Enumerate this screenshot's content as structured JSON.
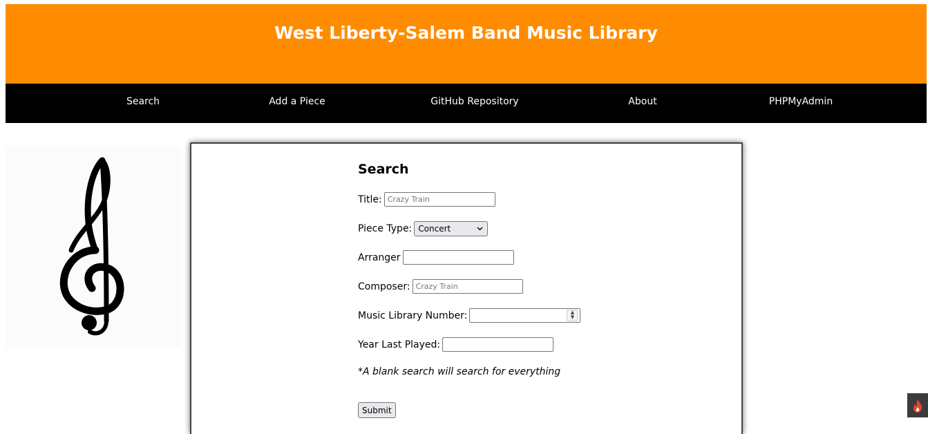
{
  "header": {
    "title": "West Liberty-Salem Band Music Library"
  },
  "nav": {
    "items": [
      {
        "label": "Search"
      },
      {
        "label": "Add a Piece"
      },
      {
        "label": "GitHub Repository"
      },
      {
        "label": "About"
      },
      {
        "label": "PHPMyAdmin"
      }
    ]
  },
  "form": {
    "heading": "Search",
    "title_label": "Title:",
    "title_placeholder": "Crazy Train",
    "piece_type_label": "Piece Type:",
    "piece_type_value": "Concert",
    "arranger_label": "Arranger",
    "composer_label": "Composer:",
    "composer_placeholder": "Crazy Train",
    "library_number_label": "Music Library Number:",
    "year_label": "Year Last Played:",
    "note": "*A blank search will search for everything",
    "submit_label": "Submit"
  },
  "colors": {
    "header": "#ff8c00",
    "nav": "#000000"
  },
  "icons": {
    "treble_clef": "treble-clef-icon",
    "flame": "flame-icon"
  }
}
